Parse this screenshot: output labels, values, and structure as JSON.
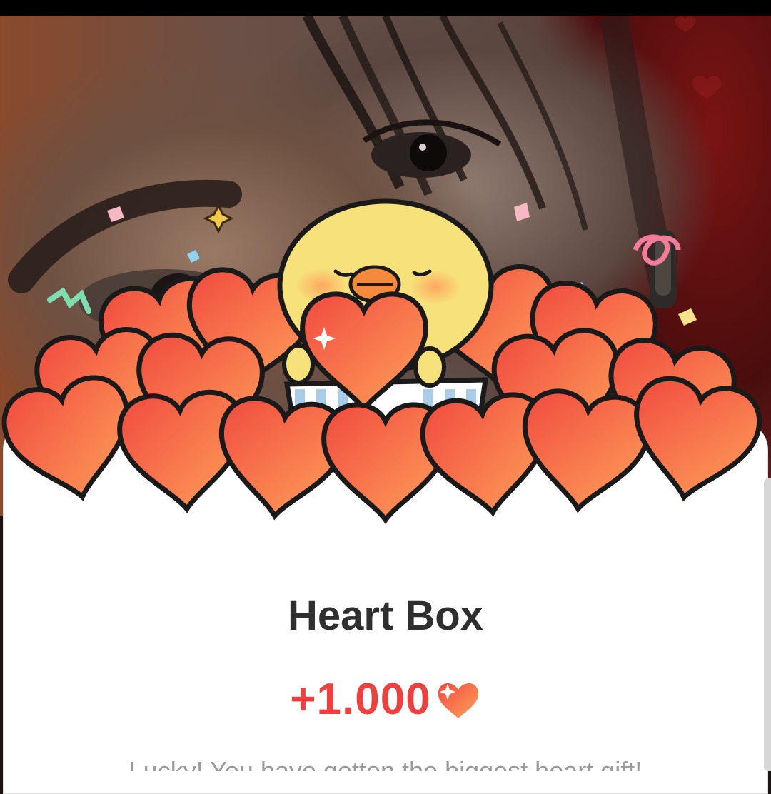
{
  "dialog": {
    "title": "Heart Box",
    "reward_amount": "+1.000",
    "reward_icon": "heart-icon",
    "subtext": "Lucky! You have gotten the biggest heart gift!"
  },
  "colors": {
    "heart_fill_top": "#f25a45",
    "heart_fill_bottom": "#ff9a55",
    "heart_outline": "#1a1a1a",
    "accent_red": "#ef3f3f",
    "chick_yellow": "#f7e17a",
    "chick_beak": "#f58a3c"
  }
}
